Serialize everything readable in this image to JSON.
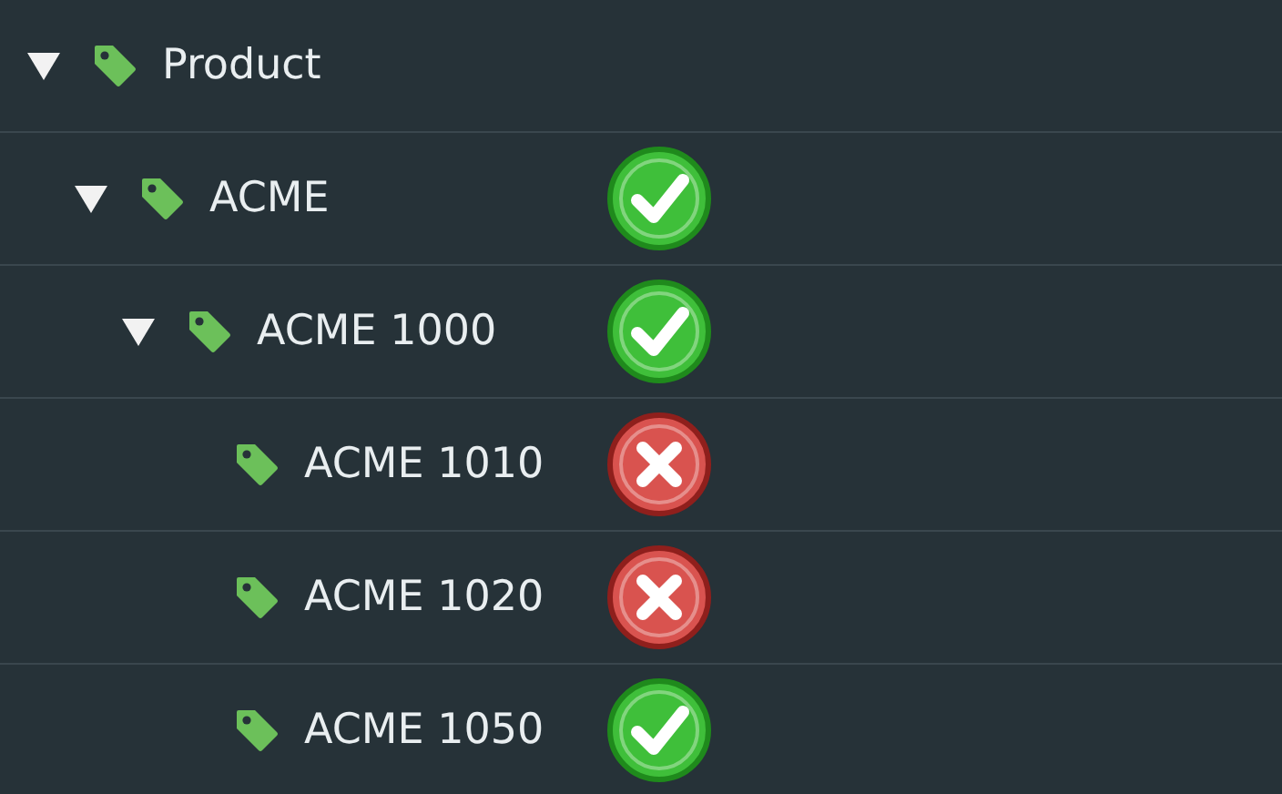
{
  "tree": [
    {
      "label": "Product",
      "expanded": true,
      "children": [
        {
          "label": "ACME",
          "expanded": true,
          "passed": true,
          "children": [
            {
              "label": "ACME 1000",
              "expanded": true,
              "passed": true,
              "children": [
                {
                  "label": "ACME 1010",
                  "passed": false
                },
                {
                  "label": "ACME 1020",
                  "passed": false
                },
                {
                  "label": "ACME 1050",
                  "passed": true
                }
              ]
            }
          ]
        }
      ]
    }
  ]
}
